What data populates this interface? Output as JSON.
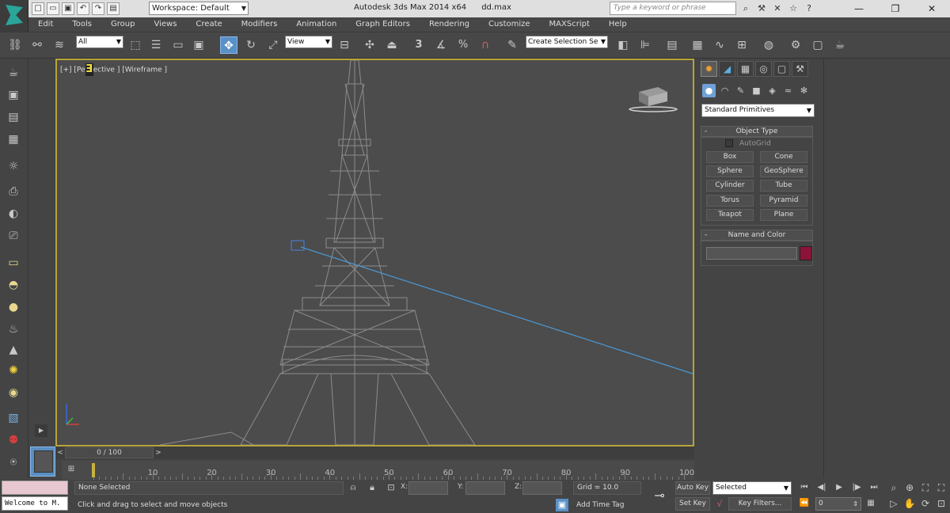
{
  "titlebar": {
    "workspace_label": "Workspace: Default",
    "app_title": "Autodesk 3ds Max  2014 x64",
    "file_name": "dd.max",
    "search_placeholder": "Type a keyword or phrase"
  },
  "menu": [
    "Edit",
    "Tools",
    "Group",
    "Views",
    "Create",
    "Modifiers",
    "Animation",
    "Graph Editors",
    "Rendering",
    "Customize",
    "MAXScript",
    "Help"
  ],
  "toolbar": {
    "selection_filter": "All",
    "ref_coord": "View",
    "snap_3": "3",
    "snap_percent": "%",
    "named_selection_placeholder": "Create Selection Se"
  },
  "viewport": {
    "label_prefix": "[+] [Pe",
    "label_suffix": "ective ] [Wireframe ]"
  },
  "command_panel": {
    "category": "Standard Primitives",
    "object_type_title": "Object Type",
    "autogrid_label": "AutoGrid",
    "buttons": [
      "Box",
      "Cone",
      "Sphere",
      "GeoSphere",
      "Cylinder",
      "Tube",
      "Torus",
      "Pyramid",
      "Teapot",
      "Plane"
    ],
    "name_color_title": "Name and Color",
    "object_color": "#8a1438"
  },
  "timeline": {
    "frame_display": "0 / 100",
    "tick_labels": [
      "10",
      "20",
      "30",
      "40",
      "50",
      "60",
      "70",
      "80",
      "90",
      "100"
    ]
  },
  "status": {
    "listener_text": "Welcome to M.",
    "selection_info": "None Selected",
    "prompt": "Click and drag to select and move objects",
    "x_label": "X:",
    "y_label": "Y:",
    "z_label": "Z:",
    "grid": "Grid = 10.0",
    "add_time_tag": "Add Time Tag",
    "auto_key": "Auto Key",
    "set_key": "Set Key",
    "key_filter_sel": "Selected",
    "key_filters": "Key Filters...",
    "current_frame": "0"
  },
  "colors": {
    "accent": "#5a90c8",
    "viewport_border": "#b7a43a",
    "light_line": "#4a9ad8",
    "wireframe": "#8c8c8c"
  }
}
